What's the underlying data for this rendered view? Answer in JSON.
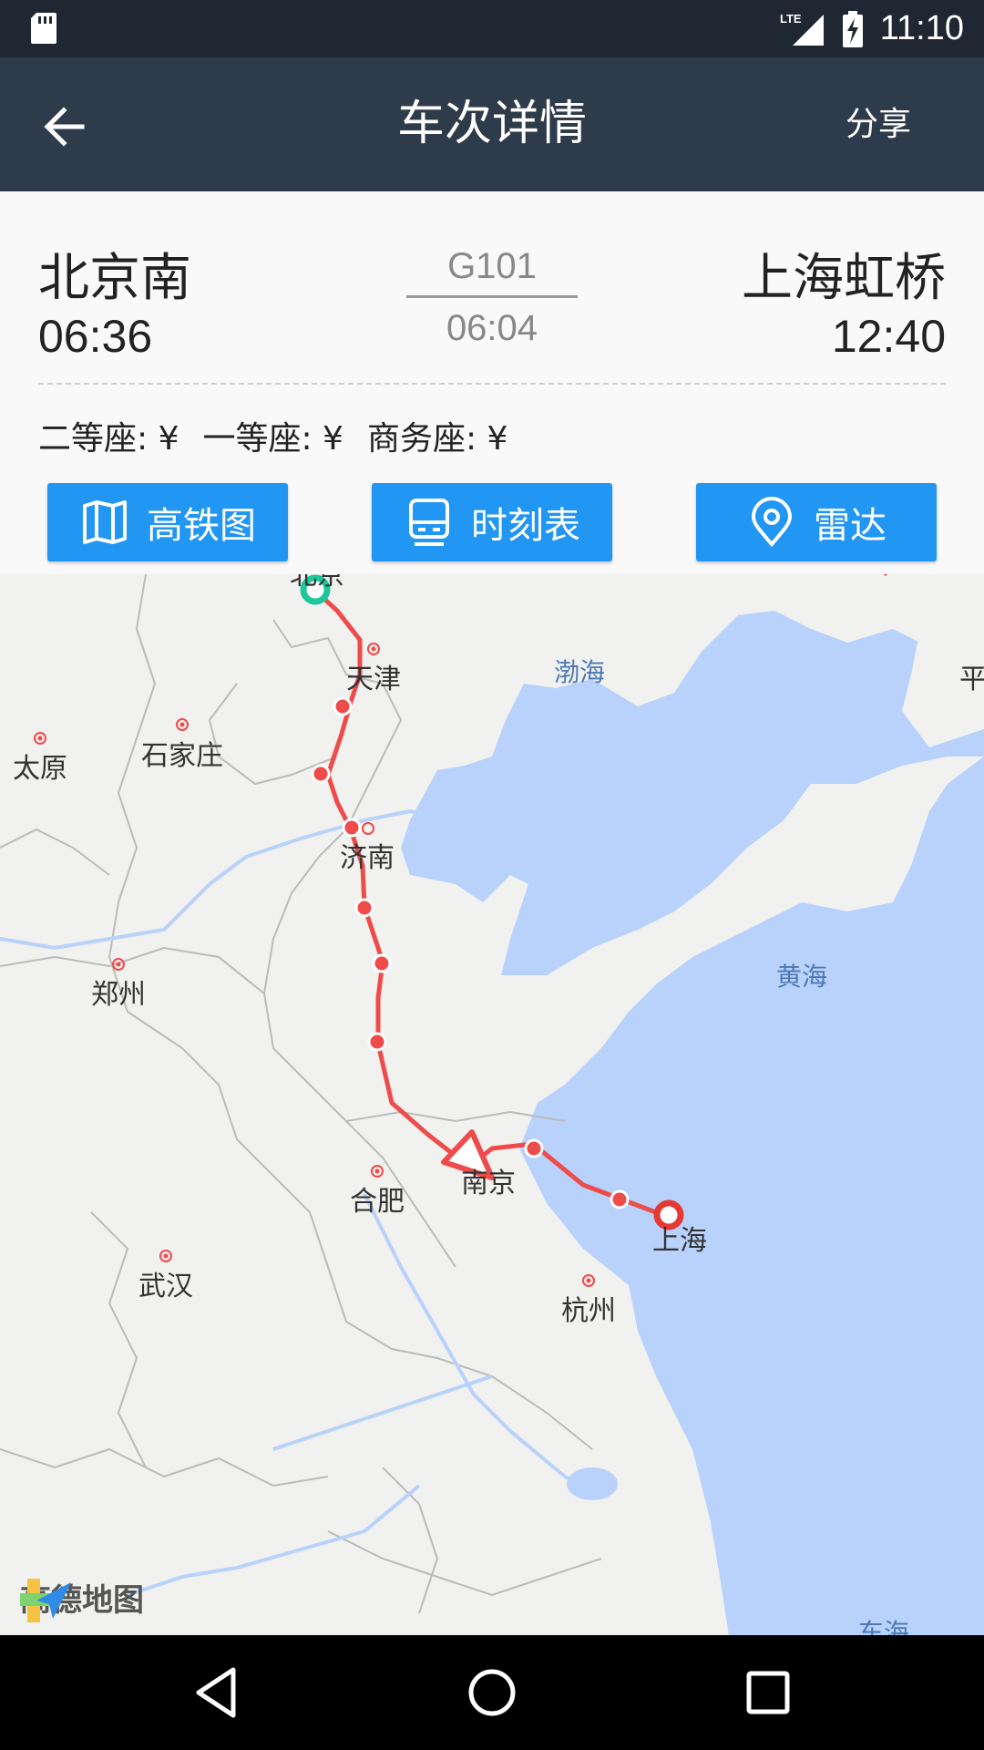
{
  "status_bar": {
    "time": "11:10",
    "network": "LTE"
  },
  "app_bar": {
    "title": "车次详情",
    "share_label": "分享"
  },
  "train": {
    "from_station": "北京南",
    "from_time": "06:36",
    "train_number": "G101",
    "duration": "06:04",
    "to_station": "上海虹桥",
    "to_time": "12:40"
  },
  "prices": {
    "second_class": "二等座: ¥",
    "first_class": "一等座: ¥",
    "business_class": "商务座: ¥"
  },
  "actions": {
    "rail_map": "高铁图",
    "timetable": "时刻表",
    "radar": "雷达"
  },
  "map": {
    "logo": "高德地图",
    "cities": {
      "beijing": "北京",
      "tianjin": "天津",
      "shijiazhuang": "石家庄",
      "taiyuan": "太原",
      "jinan": "济南",
      "zhengzhou": "郑州",
      "hefei": "合肥",
      "nanjing": "南京",
      "shanghai": "上海",
      "wuhan": "武汉",
      "hangzhou": "杭州",
      "ping_partial": "平"
    },
    "seas": {
      "bohai": "渤海",
      "huanghai": "黄海",
      "donghai": "东海"
    },
    "colors": {
      "route": "#ef4b4b",
      "start": "#1cc79a",
      "water": "#b8d2fb",
      "land": "#f1f1ef"
    }
  }
}
